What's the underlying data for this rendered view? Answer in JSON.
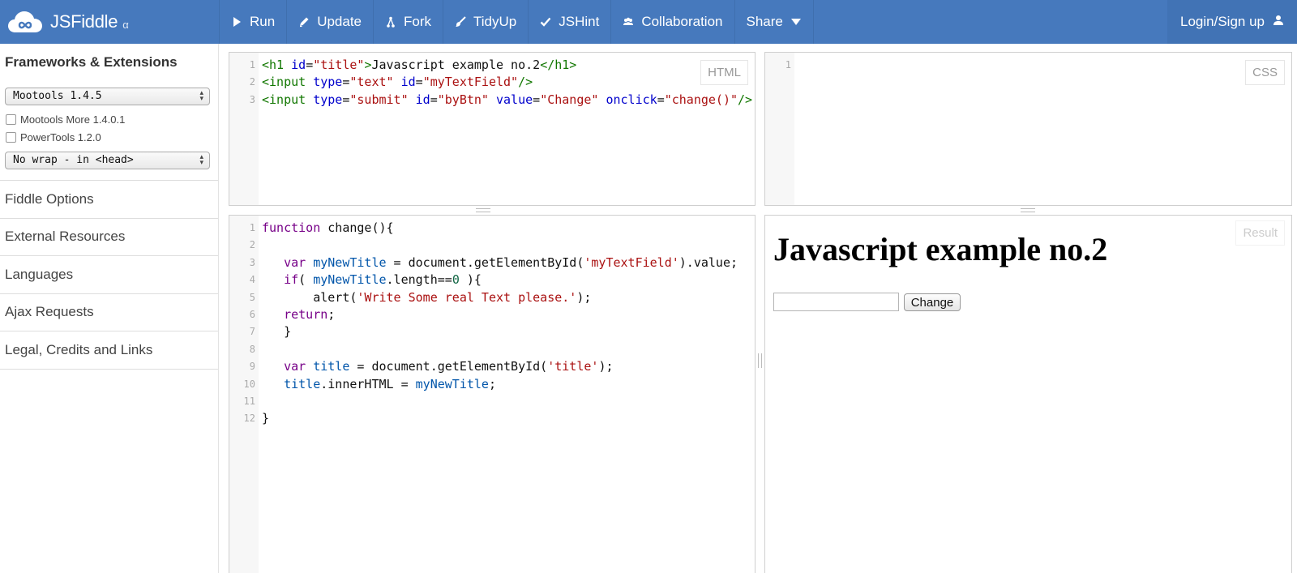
{
  "brand": {
    "name": "JSFiddle",
    "sub": "α"
  },
  "toolbar": {
    "run": "Run",
    "update": "Update",
    "fork": "Fork",
    "tidyup": "TidyUp",
    "jshint": "JSHint",
    "collaboration": "Collaboration",
    "share": "Share",
    "login": "Login/Sign up"
  },
  "sidebar": {
    "heading": "Frameworks & Extensions",
    "framework_select": "Mootools 1.4.5",
    "extensions": [
      "Mootools More 1.4.0.1",
      "PowerTools 1.2.0"
    ],
    "wrap_select": "No wrap - in <head>",
    "menu": [
      "Fiddle Options",
      "External Resources",
      "Languages",
      "Ajax Requests",
      "Legal, Credits and Links"
    ]
  },
  "panels": {
    "html_label": "HTML",
    "css_label": "CSS",
    "result_label": "Result",
    "css_lines": [
      "1"
    ]
  },
  "html_code": [
    [
      [
        "t",
        "<h1 "
      ],
      [
        "a",
        "id"
      ],
      [
        "p",
        "="
      ],
      [
        "s",
        "\"title\""
      ],
      [
        "t",
        ">"
      ],
      [
        "p",
        "Javascript example no.2"
      ],
      [
        "t",
        "</h1>"
      ]
    ],
    [
      [
        "t",
        "<input "
      ],
      [
        "a",
        "type"
      ],
      [
        "p",
        "="
      ],
      [
        "s",
        "\"text\""
      ],
      [
        "p",
        " "
      ],
      [
        "a",
        "id"
      ],
      [
        "p",
        "="
      ],
      [
        "s",
        "\"myTextField\""
      ],
      [
        "t",
        "/>"
      ]
    ],
    [
      [
        "t",
        "<input "
      ],
      [
        "a",
        "type"
      ],
      [
        "p",
        "="
      ],
      [
        "s",
        "\"submit\""
      ],
      [
        "p",
        " "
      ],
      [
        "a",
        "id"
      ],
      [
        "p",
        "="
      ],
      [
        "s",
        "\"byBtn\""
      ],
      [
        "p",
        " "
      ],
      [
        "a",
        "value"
      ],
      [
        "p",
        "="
      ],
      [
        "s",
        "\"Change\""
      ],
      [
        "p",
        " "
      ],
      [
        "a",
        "onclick"
      ],
      [
        "p",
        "="
      ],
      [
        "s",
        "\"change()\""
      ],
      [
        "t",
        "/>"
      ]
    ]
  ],
  "js_code": [
    [
      [
        "k",
        "function"
      ],
      [
        "p",
        " change(){"
      ]
    ],
    [],
    [
      [
        "p",
        "   "
      ],
      [
        "k",
        "var"
      ],
      [
        "p",
        " "
      ],
      [
        "v",
        "myNewTitle"
      ],
      [
        "p",
        " = document.getElementById("
      ],
      [
        "s",
        "'myTextField'"
      ],
      [
        "p",
        ").value;"
      ]
    ],
    [
      [
        "p",
        "   "
      ],
      [
        "k",
        "if"
      ],
      [
        "p",
        "( "
      ],
      [
        "v",
        "myNewTitle"
      ],
      [
        "p",
        ".length=="
      ],
      [
        "n",
        "0"
      ],
      [
        "p",
        " ){"
      ]
    ],
    [
      [
        "p",
        "       alert("
      ],
      [
        "s",
        "'Write Some real Text please.'"
      ],
      [
        "p",
        ");"
      ]
    ],
    [
      [
        "p",
        "   "
      ],
      [
        "k",
        "return"
      ],
      [
        "p",
        ";"
      ]
    ],
    [
      [
        "p",
        "   }"
      ]
    ],
    [],
    [
      [
        "p",
        "   "
      ],
      [
        "k",
        "var"
      ],
      [
        "p",
        " "
      ],
      [
        "v",
        "title"
      ],
      [
        "p",
        " = document.getElementById("
      ],
      [
        "s",
        "'title'"
      ],
      [
        "p",
        ");"
      ]
    ],
    [
      [
        "p",
        "   "
      ],
      [
        "v",
        "title"
      ],
      [
        "p",
        ".innerHTML = "
      ],
      [
        "v",
        "myNewTitle"
      ],
      [
        "p",
        ";"
      ]
    ],
    [],
    [
      [
        "p",
        "}"
      ]
    ]
  ],
  "result": {
    "heading": "Javascript example no.2",
    "input_value": "",
    "button_label": "Change"
  },
  "colors": {
    "topbar": "#4679bd",
    "tag": "#117700",
    "attribute": "#0000cc",
    "string": "#aa1111",
    "keyword": "#770088",
    "variable": "#0055aa",
    "number": "#116644"
  },
  "icons": [
    "cloud-logo-icon",
    "play-icon",
    "pencil-icon",
    "fork-icon",
    "brush-icon",
    "check-icon",
    "users-icon",
    "caret-down-icon",
    "user-icon"
  ]
}
